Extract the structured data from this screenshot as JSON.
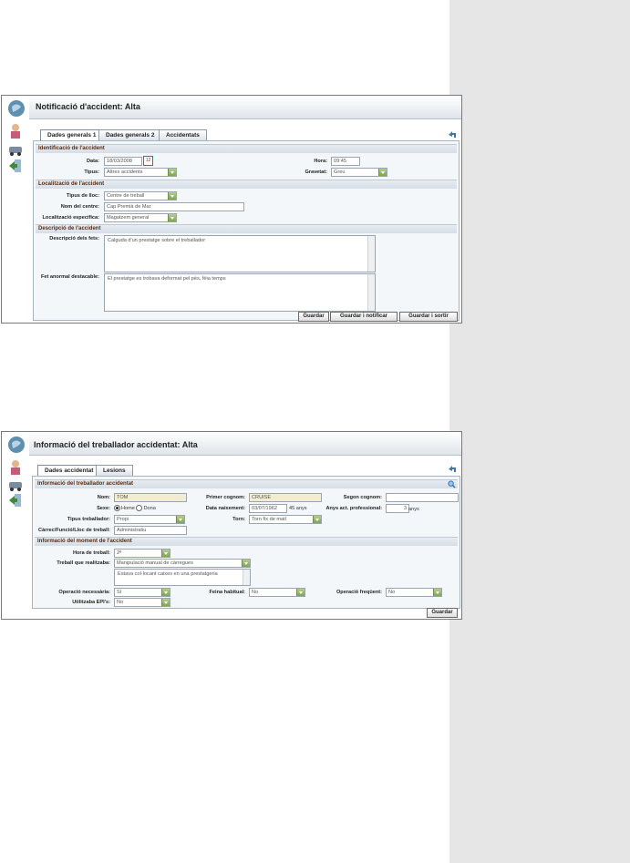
{
  "form1": {
    "title": "Notificació d'accident: Alta",
    "tabs": [
      "Dades generals 1",
      "Dades generals 2",
      "Accidentats"
    ],
    "section_identification": "Identificació de l'accident",
    "label_data": "Data:",
    "value_data": "18/03/2008",
    "calendar_day": "12",
    "label_hora": "Hora:",
    "value_hora": "09:45",
    "label_tipus": "Tipus:",
    "value_tipus": "Altres accidents",
    "label_gravetat": "Gravetat:",
    "value_gravetat": "Greu",
    "section_location": "Localització de l'accident",
    "label_tipus_lloc": "Tipus de lloc:",
    "value_tipus_lloc": "Centre de treball",
    "label_nom_centre": "Nom del centre:",
    "value_nom_centre": "Cap Premià de Mar",
    "label_localitzacio": "Localització específica:",
    "value_localitzacio": "Magatzem general",
    "section_description": "Descripció de l'accident",
    "label_descripcio": "Descripció dels fets:",
    "value_descripcio": "Calguda d'un prestatge sobre el treballador",
    "label_fet_anormal": "Fet anormal destacable:",
    "value_fet_anormal": "El prestatge es trobava deformat pel pès, fèia temps",
    "btn_guardar": "Guardar",
    "btn_guardar_notificar": "Guardar i notificar",
    "btn_guardar_sortir": "Guardar i sortir"
  },
  "form2": {
    "title": "Informació del treballador accidentat: Alta",
    "tabs": [
      "Dades accidentat",
      "Lesions"
    ],
    "section_worker": "Informació del treballador accidentat",
    "label_nom": "Nom:",
    "value_nom": "TOM",
    "label_primer_cognom": "Primer cognom:",
    "value_primer_cognom": "CRUISE",
    "label_segon_cognom": "Segon cognom:",
    "value_segon_cognom": "",
    "label_sexe": "Sexe:",
    "option_home": "Home",
    "option_dona": "Dona",
    "label_data_naixement": "Data naixement:",
    "value_data_naixement": "03/07/1962",
    "edat": "45 anys",
    "label_anys_act": "Anys act. professional:",
    "value_anys_act": "3",
    "anys_unit": "anys",
    "label_tipus_treballador": "Tipus treballador:",
    "value_tipus_treballador": "Propi",
    "label_torn": "Torn:",
    "value_torn": "Torn fix de matí",
    "label_carrec": "Càrrec/Funció/Lloc de treball:",
    "value_carrec": "Administratiu",
    "section_moment": "Informació del moment de l'accident",
    "label_hora_treball": "Hora de treball:",
    "value_hora_treball": "2ª",
    "label_treball_realitzava": "Treball que realitzaba:",
    "value_treball_realitzava": "Manipulació manual de càrregues",
    "value_treball_detall": "Estava col·locant caixes en una prestatgeria",
    "label_operacio_necessaria": "Operació necessària:",
    "value_operacio_necessaria": "Sí",
    "label_feina_habitual": "Feina habitual:",
    "value_feina_habitual": "No",
    "label_operacio_frequent": "Operació freqüent:",
    "value_operacio_frequent": "No",
    "label_epis": "Utilitzaba EPI's:",
    "value_epis": "No",
    "btn_guardar": "Guardar"
  },
  "icons": [
    "globe-logo-icon",
    "user-icon",
    "vehicle-icon",
    "exit-icon",
    "back-icon",
    "search-icon",
    "calendar-icon"
  ]
}
